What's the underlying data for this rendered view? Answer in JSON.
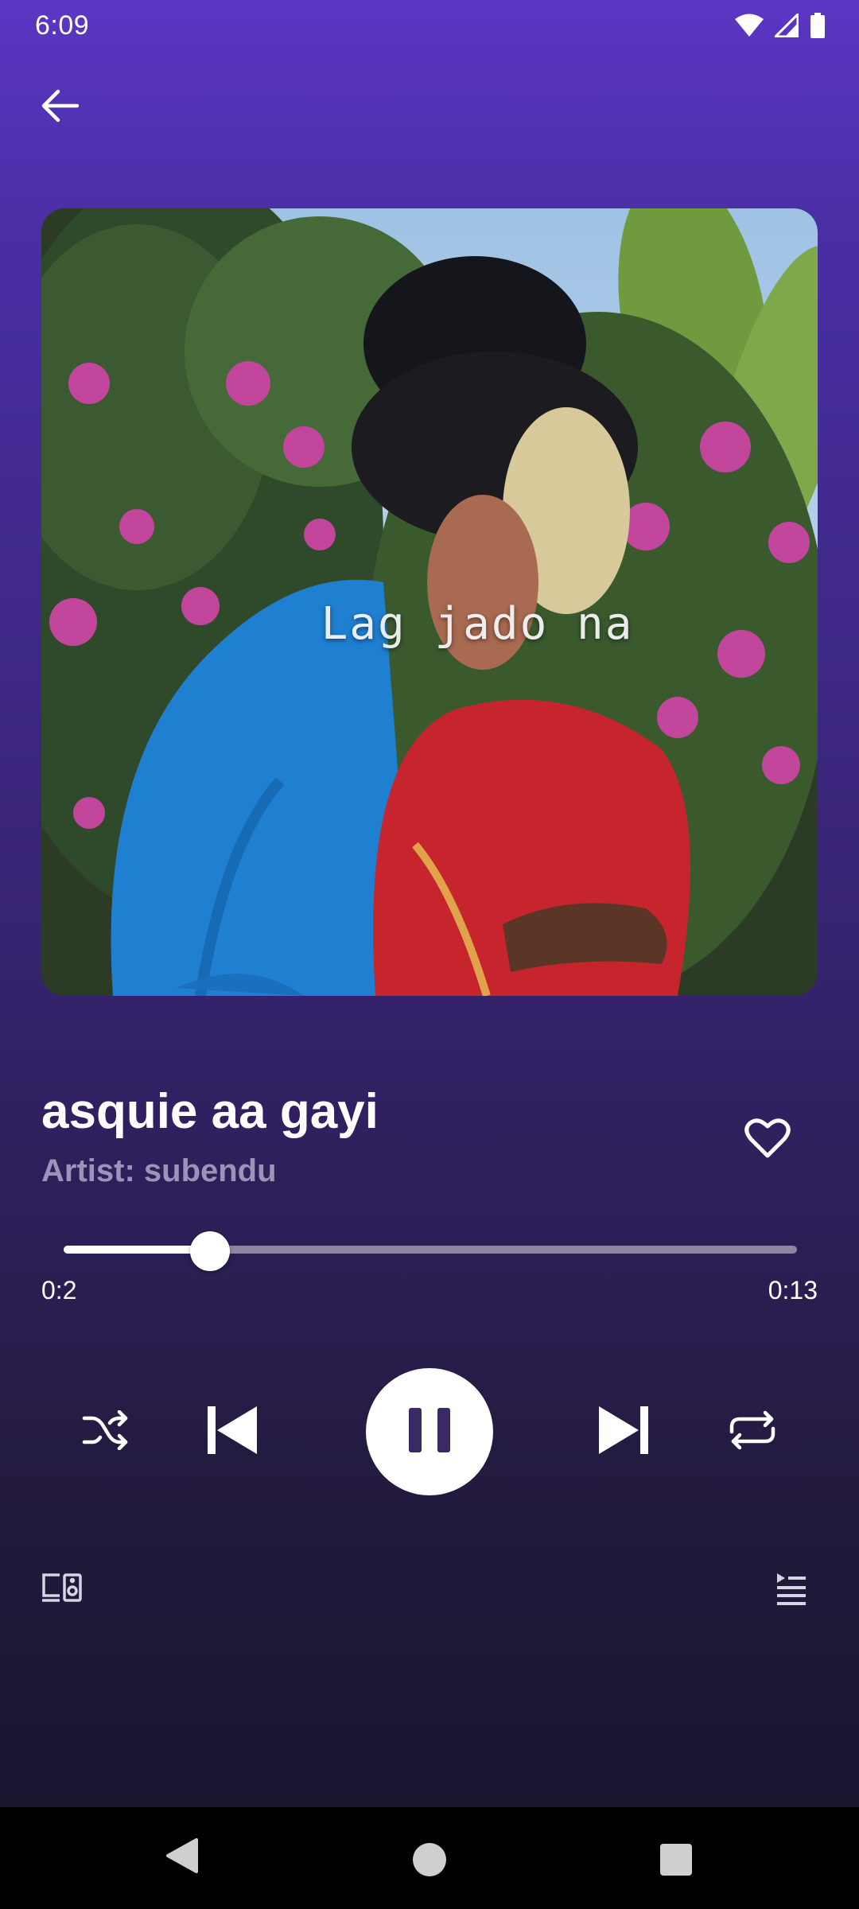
{
  "status_bar": {
    "time": "6:09",
    "icons": [
      "wifi-icon",
      "cellular-signal-icon",
      "battery-icon"
    ]
  },
  "header": {
    "back_icon": "arrow-left-icon"
  },
  "album_art": {
    "caption": "Lag jado na"
  },
  "track": {
    "title": "asquie aa gayi",
    "artist": "Artist: subendu",
    "favorite_icon": "heart-outline-icon"
  },
  "progress": {
    "elapsed": "0:2",
    "total": "0:13",
    "fraction": 0.2
  },
  "controls": {
    "shuffle_icon": "shuffle-icon",
    "previous_icon": "skip-previous-icon",
    "play_pause_icon": "pause-icon",
    "next_icon": "skip-next-icon",
    "repeat_icon": "repeat-icon"
  },
  "footer": {
    "devices_icon": "devices-icon",
    "queue_icon": "queue-list-icon"
  },
  "navigation": {
    "back_icon": "nav-back-triangle-icon",
    "home_icon": "nav-home-circle-icon",
    "recents_icon": "nav-recents-square-icon"
  },
  "colors": {
    "gradient_top": "#5b36c4",
    "gradient_bottom": "#1b1530",
    "artist_text": "#9d93b8",
    "seek_track": "#8c86a0"
  }
}
